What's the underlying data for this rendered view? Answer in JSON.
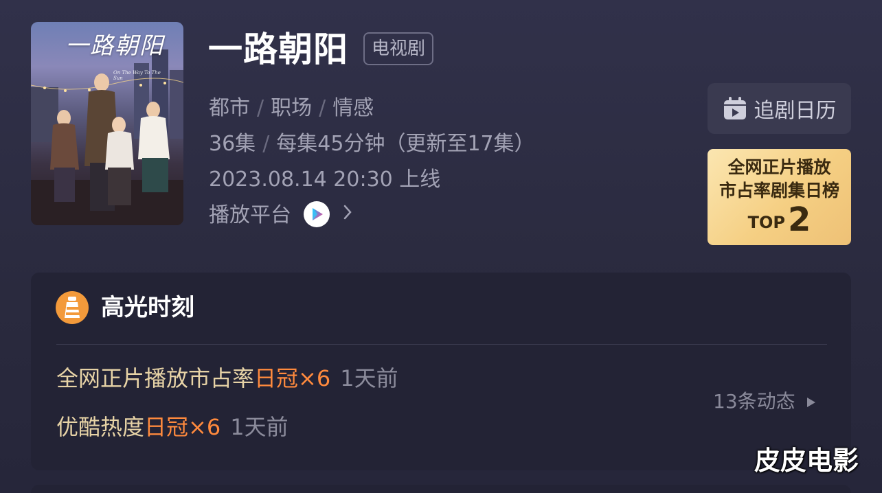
{
  "show": {
    "poster_title": "一路朝阳",
    "poster_subtitle": "On The Way To The Sun",
    "title": "一路朝阳",
    "type_badge": "电视剧",
    "genres": [
      "都市",
      "职场",
      "情感"
    ],
    "episodes": "36集",
    "episode_length": "每集45分钟（更新至17集）",
    "release": "2023.08.14 20:30 上线",
    "platform_label": "播放平台"
  },
  "actions": {
    "calendar_label": "追剧日历",
    "calendar_icon": "calendar-play-icon"
  },
  "rank": {
    "line1": "全网正片播放",
    "line2": "市占率剧集日榜",
    "top_label": "TOP",
    "top_value": "2"
  },
  "highlights": {
    "title": "高光时刻",
    "items": [
      {
        "label": "全网正片播放市占率",
        "value": "日冠×6",
        "time": "1天前"
      },
      {
        "label": "优酷热度",
        "value": "日冠×6",
        "time": "1天前"
      }
    ],
    "more_label": "13条动态"
  },
  "watermark": "皮皮电影",
  "colors": {
    "accent_orange": "#ff8a3d",
    "gold_label": "#e7d3a6",
    "rank_gold": "#f5cf83"
  }
}
